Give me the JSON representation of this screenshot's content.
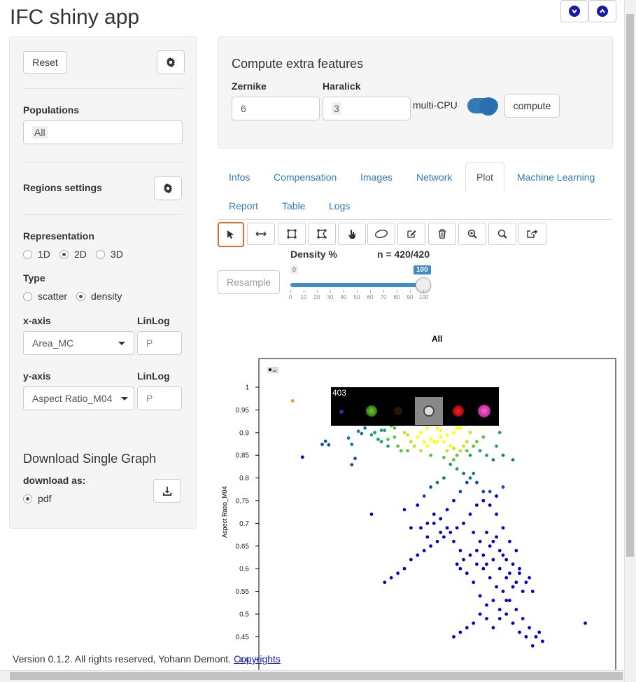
{
  "app": {
    "title": "IFC shiny app"
  },
  "sidebar": {
    "reset_label": "Reset",
    "populations_label": "Populations",
    "populations_value": "All",
    "regions_label": "Regions settings",
    "representation_label": "Representation",
    "representation_options": [
      "1D",
      "2D",
      "3D"
    ],
    "representation_selected": "2D",
    "type_label": "Type",
    "type_options": [
      "scatter",
      "density"
    ],
    "type_selected": "density",
    "xaxis_label": "x-axis",
    "xaxis_value": "Area_MC",
    "linlog_label": "LinLog",
    "xaxis_linlog": "P",
    "yaxis_label": "y-axis",
    "yaxis_value": "Aspect Ratio_M04",
    "yaxis_linlog": "P",
    "download_title": "Download Single Graph",
    "download_as_label": "download as:",
    "download_format": "pdf"
  },
  "extra_features": {
    "title": "Compute extra features",
    "zernike_label": "Zernike",
    "zernike_value": "6",
    "haralick_label": "Haralick",
    "haralick_value": "3",
    "multicpu_label": "multi-CPU",
    "compute_label": "compute"
  },
  "tabs": {
    "row1": [
      "Infos",
      "Compensation",
      "Images",
      "Network",
      "Plot",
      "Machine Learning"
    ],
    "row2": [
      "Report",
      "Table",
      "Logs"
    ],
    "active": "Plot"
  },
  "density": {
    "resample_label": "Resample",
    "label": "Density %",
    "n_text": "n = 420/420",
    "min_badge": "0",
    "value": 100,
    "value_badge": "100",
    "ticks": [
      "0",
      "10",
      "20",
      "30",
      "40",
      "50",
      "60",
      "70",
      "80",
      "90",
      "100"
    ]
  },
  "icons": {
    "settings": "gear-icon",
    "nav_down": "chevron-down-circle-icon",
    "nav_up": "chevron-up-circle-icon",
    "download": "download-icon",
    "tools": [
      "cursor-icon",
      "horizontal-arrows-icon",
      "square-gate-icon",
      "polygon-gate-icon",
      "hand-pointer-icon",
      "ellipse-gate-icon",
      "edit-icon",
      "trash-icon",
      "zoom-in-icon",
      "search-icon",
      "export-icon"
    ]
  },
  "plot": {
    "title": "All",
    "ylabel": "Aspect Ratio_M04",
    "tooltip_id": "403",
    "yticks": [
      "1",
      "0.95",
      "0.9",
      "0.85",
      "0.8",
      "0.75",
      "0.7",
      "0.65",
      "0.6",
      "0.55",
      "0.5",
      "0.45",
      "0.4"
    ],
    "legend_label": "All"
  },
  "colors": {
    "accent": "#337ab7",
    "selected_tool_border": "#e8692a",
    "point_low": "#0000c8",
    "point_mid": "#1a9a80",
    "point_high": "#ffff00",
    "highlight": "#f0a020"
  },
  "chart_data": {
    "type": "scatter",
    "title": "All",
    "xlabel": "",
    "ylabel": "Aspect Ratio_M04",
    "ylim": [
      0.4,
      1.02
    ],
    "xlim": [
      0,
      1
    ],
    "density_colored": true,
    "series": [
      {
        "name": "All",
        "points": [
          [
            0.09,
            0.846
          ],
          [
            0.15,
            0.874
          ],
          [
            0.16,
            0.881
          ],
          [
            0.17,
            0.873
          ],
          [
            0.24,
            0.874
          ],
          [
            0.24,
            0.829
          ],
          [
            0.25,
            0.843
          ],
          [
            0.23,
            0.888
          ],
          [
            0.26,
            0.903
          ],
          [
            0.27,
            0.898
          ],
          [
            0.28,
            0.91
          ],
          [
            0.29,
            0.92
          ],
          [
            0.3,
            0.895
          ],
          [
            0.31,
            0.9
          ],
          [
            0.32,
            0.885
          ],
          [
            0.33,
            0.88
          ],
          [
            0.34,
            0.905
          ],
          [
            0.35,
            0.87
          ],
          [
            0.36,
            0.915
          ],
          [
            0.37,
            0.91
          ],
          [
            0.38,
            0.87
          ],
          [
            0.39,
            0.86
          ],
          [
            0.4,
            0.9
          ],
          [
            0.41,
            0.895
          ],
          [
            0.42,
            0.88
          ],
          [
            0.43,
            0.87
          ],
          [
            0.44,
            0.89
          ],
          [
            0.45,
            0.9
          ],
          [
            0.46,
            0.88
          ],
          [
            0.47,
            0.87
          ],
          [
            0.48,
            0.885
          ],
          [
            0.49,
            0.88
          ],
          [
            0.5,
            0.88
          ],
          [
            0.51,
            0.89
          ],
          [
            0.52,
            0.88
          ],
          [
            0.53,
            0.86
          ],
          [
            0.54,
            0.87
          ],
          [
            0.55,
            0.9
          ],
          [
            0.56,
            0.85
          ],
          [
            0.57,
            0.86
          ],
          [
            0.58,
            0.87
          ],
          [
            0.59,
            0.86
          ],
          [
            0.46,
            0.92
          ],
          [
            0.48,
            0.93
          ],
          [
            0.5,
            0.94
          ],
          [
            0.52,
            0.95
          ],
          [
            0.53,
            0.92
          ],
          [
            0.55,
            0.93
          ],
          [
            0.56,
            0.91
          ],
          [
            0.54,
            0.94
          ],
          [
            0.5,
            0.91
          ],
          [
            0.47,
            0.91
          ],
          [
            0.45,
            0.93
          ],
          [
            0.43,
            0.94
          ],
          [
            0.41,
            0.95
          ],
          [
            0.44,
            0.99
          ],
          [
            0.42,
            0.985
          ],
          [
            0.4,
            0.99
          ],
          [
            0.38,
            0.985
          ],
          [
            0.36,
            0.995
          ],
          [
            0.34,
            0.985
          ],
          [
            0.46,
            0.985
          ],
          [
            0.48,
            0.99
          ],
          [
            0.5,
            0.98
          ],
          [
            0.52,
            0.99
          ],
          [
            0.54,
            0.985
          ],
          [
            0.56,
            0.98
          ],
          [
            0.58,
            0.985
          ],
          [
            0.6,
            0.965
          ],
          [
            0.62,
            0.95
          ],
          [
            0.63,
            0.92
          ],
          [
            0.58,
            0.95
          ],
          [
            0.57,
            0.91
          ],
          [
            0.6,
            0.9
          ],
          [
            0.61,
            0.87
          ],
          [
            0.27,
            0.99
          ],
          [
            0.33,
            0.905
          ],
          [
            0.35,
            0.885
          ],
          [
            0.37,
            0.89
          ],
          [
            0.39,
            0.92
          ],
          [
            0.51,
            0.905
          ],
          [
            0.49,
            0.925
          ],
          [
            0.47,
            0.935
          ],
          [
            0.53,
            0.895
          ],
          [
            0.55,
            0.865
          ],
          [
            0.6,
            0.85
          ],
          [
            0.55,
            0.84
          ],
          [
            0.52,
            0.845
          ],
          [
            0.48,
            0.85
          ],
          [
            0.45,
            0.86
          ],
          [
            0.41,
            0.86
          ],
          [
            0.63,
            0.86
          ],
          [
            0.65,
            0.85
          ],
          [
            0.67,
            0.84
          ],
          [
            0.69,
            0.9
          ],
          [
            0.59,
            0.88
          ],
          [
            0.62,
            0.88
          ],
          [
            0.64,
            0.89
          ],
          [
            0.68,
            0.87
          ],
          [
            0.7,
            0.85
          ],
          [
            0.73,
            0.84
          ],
          [
            0.7,
            0.78
          ],
          [
            0.68,
            0.76
          ],
          [
            0.66,
            0.77
          ],
          [
            0.64,
            0.75
          ],
          [
            0.62,
            0.74
          ],
          [
            0.6,
            0.72
          ],
          [
            0.58,
            0.7
          ],
          [
            0.56,
            0.69
          ],
          [
            0.54,
            0.68
          ],
          [
            0.52,
            0.67
          ],
          [
            0.5,
            0.66
          ],
          [
            0.48,
            0.65
          ],
          [
            0.46,
            0.64
          ],
          [
            0.44,
            0.63
          ],
          [
            0.42,
            0.62
          ],
          [
            0.4,
            0.6
          ],
          [
            0.38,
            0.59
          ],
          [
            0.36,
            0.58
          ],
          [
            0.34,
            0.57
          ],
          [
            0.56,
            0.61
          ],
          [
            0.58,
            0.62
          ],
          [
            0.6,
            0.63
          ],
          [
            0.62,
            0.64
          ],
          [
            0.64,
            0.6
          ],
          [
            0.66,
            0.58
          ],
          [
            0.68,
            0.56
          ],
          [
            0.7,
            0.55
          ],
          [
            0.72,
            0.53
          ],
          [
            0.74,
            0.51
          ],
          [
            0.76,
            0.49
          ],
          [
            0.78,
            0.47
          ],
          [
            0.8,
            0.45
          ],
          [
            0.82,
            0.44
          ],
          [
            0.65,
            0.52
          ],
          [
            0.63,
            0.5
          ],
          [
            0.61,
            0.48
          ],
          [
            0.59,
            0.47
          ],
          [
            0.57,
            0.46
          ],
          [
            0.55,
            0.45
          ],
          [
            0.67,
            0.47
          ],
          [
            0.69,
            0.49
          ],
          [
            0.71,
            0.53
          ],
          [
            0.73,
            0.56
          ],
          [
            0.75,
            0.6
          ],
          [
            0.77,
            0.57
          ],
          [
            0.79,
            0.55
          ],
          [
            0.78,
            0.58
          ],
          [
            0.74,
            0.64
          ],
          [
            0.72,
            0.66
          ],
          [
            0.7,
            0.69
          ],
          [
            0.68,
            0.72
          ],
          [
            0.66,
            0.74
          ],
          [
            0.64,
            0.77
          ],
          [
            0.62,
            0.79
          ],
          [
            0.6,
            0.8
          ],
          [
            0.58,
            0.81
          ],
          [
            0.56,
            0.82
          ],
          [
            0.54,
            0.83
          ],
          [
            0.52,
            0.8
          ],
          [
            0.5,
            0.79
          ],
          [
            0.48,
            0.78
          ],
          [
            0.46,
            0.76
          ],
          [
            0.44,
            0.74
          ],
          [
            0.3,
            0.72
          ],
          [
            0.4,
            0.73
          ],
          [
            0.42,
            0.69
          ],
          [
            0.45,
            0.69
          ],
          [
            0.47,
            0.67
          ],
          [
            0.49,
            0.7
          ],
          [
            0.51,
            0.71
          ],
          [
            0.53,
            0.73
          ],
          [
            0.55,
            0.75
          ],
          [
            0.57,
            0.77
          ],
          [
            0.59,
            0.79
          ],
          [
            0.61,
            0.81
          ],
          [
            0.65,
            0.68
          ],
          [
            0.67,
            0.66
          ],
          [
            0.69,
            0.64
          ],
          [
            0.71,
            0.62
          ],
          [
            0.73,
            0.61
          ],
          [
            0.75,
            0.59
          ],
          [
            0.63,
            0.66
          ],
          [
            0.61,
            0.68
          ],
          [
            0.57,
            0.64
          ],
          [
            0.55,
            0.66
          ],
          [
            0.53,
            0.69
          ],
          [
            0.51,
            0.68
          ],
          [
            0.49,
            0.72
          ],
          [
            0.47,
            0.7
          ],
          [
            0.62,
            0.61
          ],
          [
            0.64,
            0.63
          ],
          [
            0.66,
            0.65
          ],
          [
            0.68,
            0.67
          ],
          [
            0.7,
            0.63
          ],
          [
            0.72,
            0.59
          ],
          [
            0.74,
            0.57
          ],
          [
            0.76,
            0.55
          ],
          [
            0.95,
            0.48
          ],
          [
            0.65,
            0.49
          ],
          [
            0.67,
            0.53
          ],
          [
            0.69,
            0.51
          ],
          [
            0.71,
            0.5
          ],
          [
            0.73,
            0.48
          ],
          [
            0.75,
            0.46
          ],
          [
            0.77,
            0.45
          ],
          [
            0.79,
            0.43
          ],
          [
            0.81,
            0.46
          ],
          [
            0.63,
            0.54
          ],
          [
            0.61,
            0.57
          ],
          [
            0.59,
            0.59
          ],
          [
            0.57,
            0.6
          ],
          [
            0.65,
            0.61
          ],
          [
            0.67,
            0.62
          ],
          [
            0.69,
            0.6
          ],
          [
            0.71,
            0.58
          ],
          [
            0.06,
            0.97
          ]
        ]
      }
    ]
  }
}
